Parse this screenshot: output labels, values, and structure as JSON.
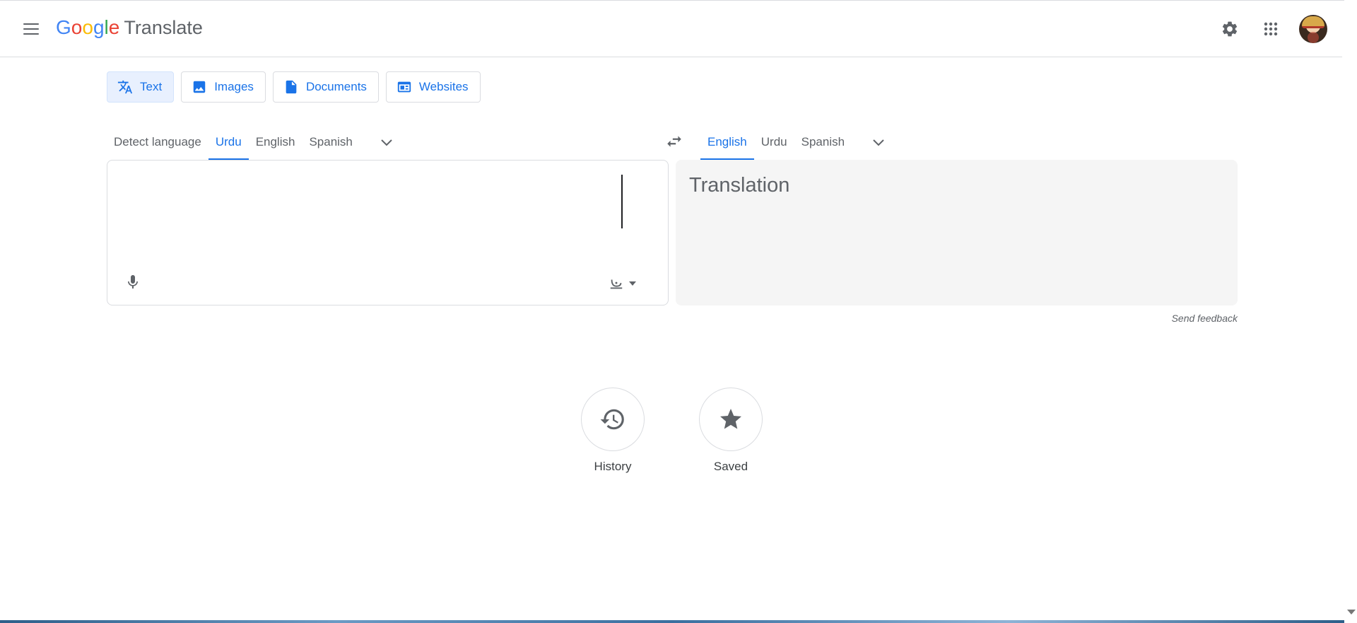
{
  "app": {
    "logo_letters": [
      {
        "char": "G",
        "color": "#4285F4"
      },
      {
        "char": "o",
        "color": "#EA4335"
      },
      {
        "char": "o",
        "color": "#FBBC05"
      },
      {
        "char": "g",
        "color": "#4285F4"
      },
      {
        "char": "l",
        "color": "#34A853"
      },
      {
        "char": "e",
        "color": "#EA4335"
      }
    ],
    "product_name": "Translate"
  },
  "header": {
    "menu_icon": "hamburger-menu-icon",
    "settings_icon": "gear-icon",
    "apps_icon": "apps-grid-icon",
    "avatar_icon": "account-avatar"
  },
  "mode_tabs": [
    {
      "label": "Text",
      "icon": "translate-icon",
      "active": true
    },
    {
      "label": "Images",
      "icon": "image-icon",
      "active": false
    },
    {
      "label": "Documents",
      "icon": "document-icon",
      "active": false
    },
    {
      "label": "Websites",
      "icon": "website-icon",
      "active": false
    }
  ],
  "source_languages": {
    "items": [
      {
        "label": "Detect language",
        "active": false
      },
      {
        "label": "Urdu",
        "active": true
      },
      {
        "label": "English",
        "active": false
      },
      {
        "label": "Spanish",
        "active": false
      }
    ]
  },
  "target_languages": {
    "items": [
      {
        "label": "English",
        "active": true
      },
      {
        "label": "Urdu",
        "active": false
      },
      {
        "label": "Spanish",
        "active": false
      }
    ]
  },
  "source_box": {
    "value": "",
    "mic_icon": "microphone-icon",
    "input_tools_icon": "keyboard-input-tools-icon"
  },
  "target_box": {
    "placeholder": "Translation"
  },
  "feedback_label": "Send feedback",
  "shortcuts": {
    "history_label": "History",
    "saved_label": "Saved"
  },
  "colors": {
    "accent": "#1a73e8",
    "active_tab_bg": "#e8f0fe",
    "translation_bg": "#f5f5f5"
  }
}
